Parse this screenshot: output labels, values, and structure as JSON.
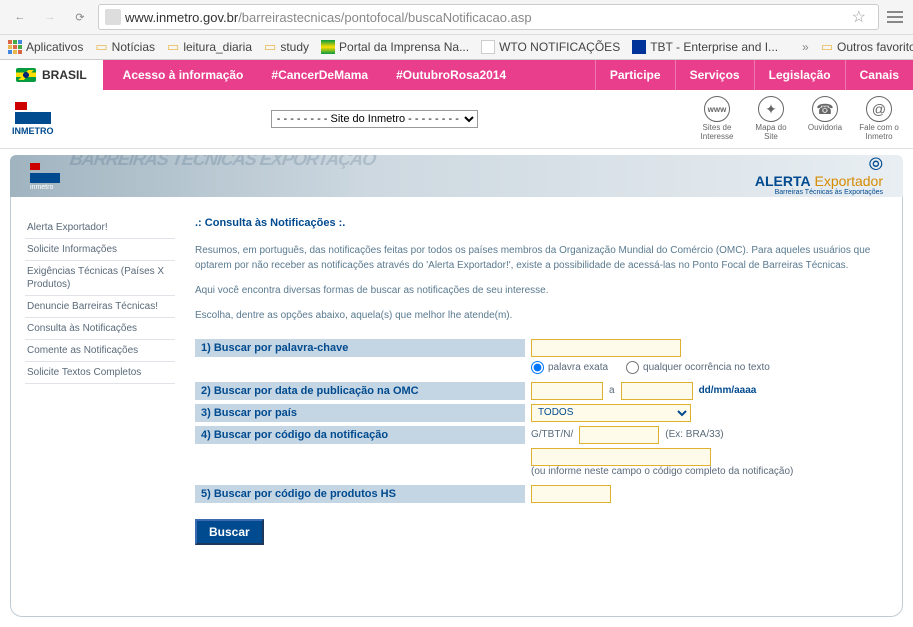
{
  "browser": {
    "url_host": "www.inmetro.gov.br",
    "url_path": "/barreirastecnicas/pontofocal/buscaNotificacao.asp"
  },
  "bookmarks": {
    "apps": "Aplicativos",
    "items": [
      "Notícias",
      "leitura_diaria",
      "study"
    ],
    "portal": "Portal da Imprensa Na...",
    "wto": "WTO NOTIFICAÇÕES",
    "tbt": "TBT - Enterprise and I...",
    "more": "»",
    "outros": "Outros favoritos"
  },
  "govbar": {
    "brasil": "BRASIL",
    "acesso": "Acesso à informação",
    "hash1": "#CancerDeMama",
    "hash2": "#OutubroRosa2014",
    "participe": "Participe",
    "servicos": "Serviços",
    "legislacao": "Legislação",
    "canais": "Canais"
  },
  "header": {
    "logo_text": "INMETRO",
    "site_select": "- - - - - - - - Site do Inmetro - - - - - - - -",
    "icons": [
      {
        "glyph": "www",
        "label": "Sites de Interesse"
      },
      {
        "glyph": "✦",
        "label": "Mapa do Site"
      },
      {
        "glyph": "☎",
        "label": "Ouvidoria"
      },
      {
        "glyph": "@",
        "label": "Fale com o Inmetro"
      }
    ]
  },
  "alerta": {
    "brand_bold": "ALERTA",
    "brand_light": "Exportador",
    "brand_sub": "Barreiras Técnicas às Exportações",
    "bg_text": "BARREIRAS TÉCNICAS EXPORTAÇÃO"
  },
  "sidebar": {
    "items": [
      "Alerta Exportador!",
      "Solicite Informações",
      "Exigências Técnicas (Países X Produtos)",
      "Denuncie Barreiras Técnicas!",
      "Consulta às Notificações",
      "Comente as Notificações",
      "Solicite Textos Completos"
    ]
  },
  "content": {
    "title": ".: Consulta às Notificações :.",
    "para1": "Resumos, em português, das notificações feitas por todos os países membros da Organização Mundial do Comércio (OMC). Para aqueles usuários que optarem por não receber as notificações através do 'Alerta Exportador!', existe a possibilidade de acessá-las no Ponto Focal de Barreiras Técnicas.",
    "para2": "Aqui você encontra diversas formas de buscar as notificações de seu interesse.",
    "para3": "Escolha, dentre as opções abaixo, aquela(s) que melhor lhe atende(m).",
    "labels": {
      "f1": "1) Buscar por palavra-chave",
      "f2": "2) Buscar por data de publicação na OMC",
      "f3": "3) Buscar por país",
      "f4": "4) Buscar por código da notificação",
      "f5": "5) Buscar por código de produtos HS"
    },
    "radio_exact": "palavra exata",
    "radio_any": "qualquer ocorrência no texto",
    "date_sep": "a",
    "date_hint": "dd/mm/aaaa",
    "country_default": "TODOS",
    "code_prefix": "G/TBT/N/",
    "code_hint": "(Ex: BRA/33)",
    "code_full_hint": "(ou informe neste campo o código completo da notificação)",
    "submit": "Buscar"
  }
}
